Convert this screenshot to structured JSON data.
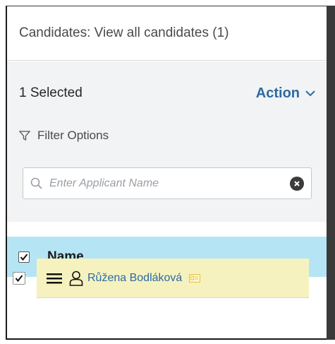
{
  "header": {
    "title": "Candidates: View all candidates (1)"
  },
  "toolbar": {
    "selected_text": "1 Selected",
    "action_label": "Action"
  },
  "filter": {
    "label": "Filter Options"
  },
  "search": {
    "placeholder": "Enter Applicant Name",
    "value": ""
  },
  "table": {
    "header_checked": true,
    "columns": [
      {
        "label": "Name"
      }
    ],
    "rows": [
      {
        "name": "Růžena Bodláková",
        "checked": true
      }
    ]
  },
  "colors": {
    "accent": "#2b6aa3",
    "panel_bg": "#f2f3f4",
    "header_row_bg": "#b5e4f5",
    "selected_row_bg": "#f6f2bf"
  },
  "icons": [
    "chevron-down-icon",
    "filter-icon",
    "search-icon",
    "clear-icon",
    "checkmark-icon",
    "drag-handle-icon",
    "person-icon",
    "card-icon"
  ]
}
